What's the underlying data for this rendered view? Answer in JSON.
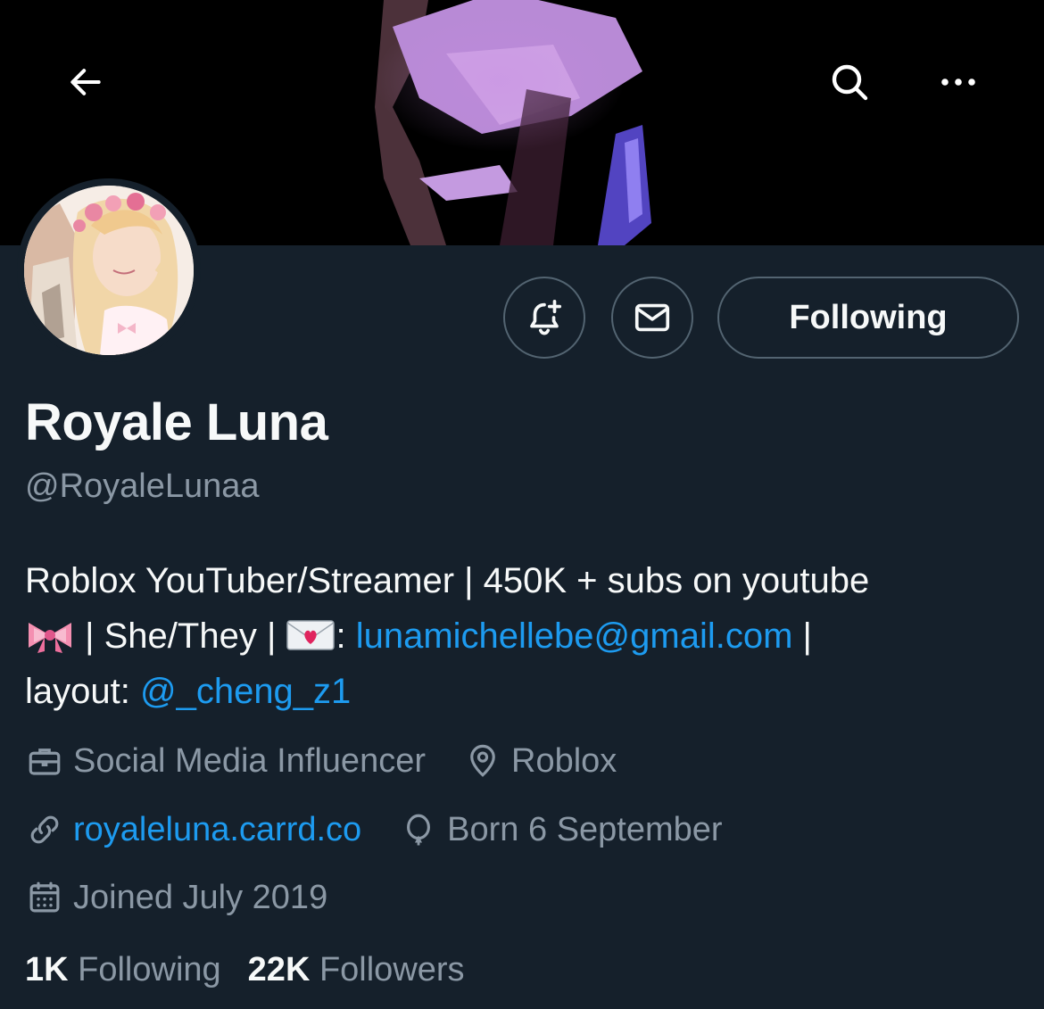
{
  "nav": {
    "back_icon": "back-arrow-icon",
    "search_icon": "search-icon",
    "more_icon": "more-horizontal-icon"
  },
  "profile": {
    "display_name": "Royale Luna",
    "handle": "@RoyaleLunaa",
    "bio": {
      "line1": "Roblox YouTuber/Streamer | 450K + subs on youtube",
      "line2_text1": " | She/They | ",
      "line2_text2": ": ",
      "email": "lunamichellebe@gmail.com",
      "line2_text3": " |",
      "line3_text1": "layout: ",
      "mention": "@_cheng_z1"
    },
    "meta": {
      "profession": "Social Media Influencer",
      "location": "Roblox",
      "website": "royaleluna.carrd.co",
      "birthday": "Born 6 September",
      "joined": "Joined July 2019"
    },
    "stats": {
      "following_count": "1K",
      "following_label": "Following",
      "followers_count": "22K",
      "followers_label": "Followers"
    }
  },
  "actions": {
    "notify_icon": "bell-plus-icon",
    "message_icon": "envelope-icon",
    "follow_label": "Following"
  },
  "colors": {
    "background": "#15202b",
    "text": "#f7f9f9",
    "muted": "#8b98a5",
    "link": "#1d9bf0",
    "border": "#536471"
  }
}
